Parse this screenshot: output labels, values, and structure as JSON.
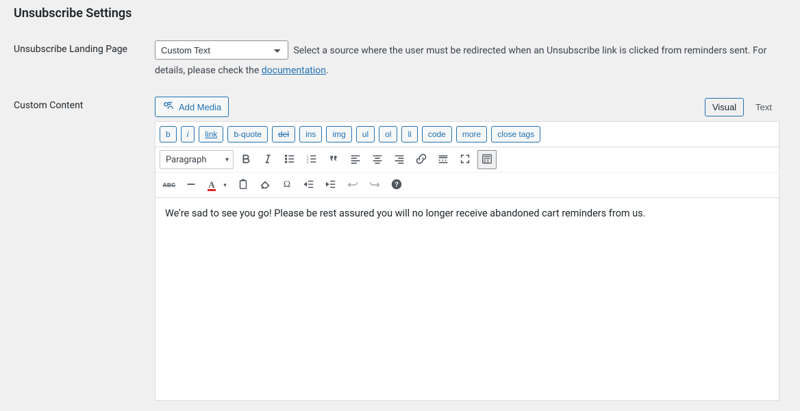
{
  "section": {
    "title": "Unsubscribe Settings"
  },
  "rows": {
    "landing": {
      "label": "Unsubscribe Landing Page",
      "select_value": "Custom Text",
      "desc_inline": "Select a source where the user must be redirected when an Unsubscribe link is clicked from reminders sent. For",
      "desc_block_pre": "details, please check the ",
      "doc_link_text": "documentation",
      "desc_block_post": "."
    },
    "content": {
      "label": "Custom Content"
    }
  },
  "editor": {
    "add_media": "Add Media",
    "tabs": {
      "visual": "Visual",
      "text": "Text"
    },
    "quicktags": {
      "b": "b",
      "i": "i",
      "link": "link",
      "bquote": "b-quote",
      "del": "del",
      "ins": "ins",
      "img": "img",
      "ul": "ul",
      "ol": "ol",
      "li": "li",
      "code": "code",
      "more": "more",
      "close": "close tags"
    },
    "format_select": "Paragraph",
    "strikethrough_label": "ABC",
    "textcolor_letter": "A",
    "omega": "Ω",
    "body": "We're sad to see you go! Please be rest assured you will no longer receive abandoned cart reminders from us."
  }
}
